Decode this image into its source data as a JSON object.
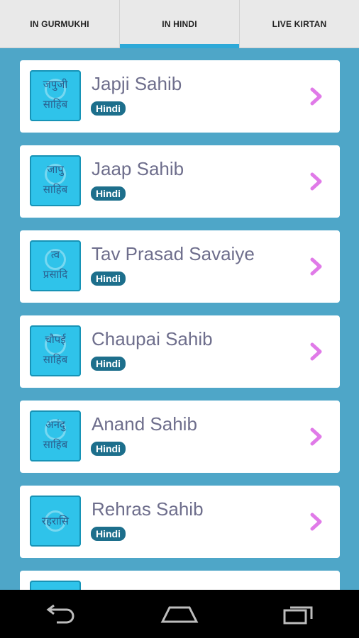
{
  "tabs": [
    {
      "label": "IN GURMUKHI",
      "active": false
    },
    {
      "label": "IN HINDI",
      "active": true
    },
    {
      "label": "LIVE KIRTAN",
      "active": false
    }
  ],
  "items": [
    {
      "title": "Japji Sahib",
      "badge": "Hindi",
      "thumb_line1": "जपुजी",
      "thumb_line2": "साहिब"
    },
    {
      "title": "Jaap Sahib",
      "badge": "Hindi",
      "thumb_line1": "जापु",
      "thumb_line2": "साहिब"
    },
    {
      "title": "Tav Prasad Savaiye",
      "badge": "Hindi",
      "thumb_line1": "त्व",
      "thumb_line2": "प्रसादि"
    },
    {
      "title": "Chaupai Sahib",
      "badge": "Hindi",
      "thumb_line1": "चौपई",
      "thumb_line2": "साहिब"
    },
    {
      "title": "Anand Sahib",
      "badge": "Hindi",
      "thumb_line1": "अनंदु",
      "thumb_line2": "साहिब"
    },
    {
      "title": "Rehras Sahib",
      "badge": "Hindi",
      "thumb_line1": "",
      "thumb_line2": "रहरासि"
    },
    {
      "title": "",
      "badge": "",
      "thumb_line1": "",
      "thumb_line2": ""
    }
  ],
  "colors": {
    "background": "#4ea6c8",
    "tab_indicator": "#2ea9d8",
    "badge": "#1d6f8c",
    "chevron": "#e07ae8",
    "title_text": "#6e6e8c",
    "thumb": "#2fc3ea"
  },
  "icons": {
    "chevron": "chevron-right-icon",
    "back": "back-icon",
    "home": "home-icon",
    "recents": "recents-icon"
  }
}
